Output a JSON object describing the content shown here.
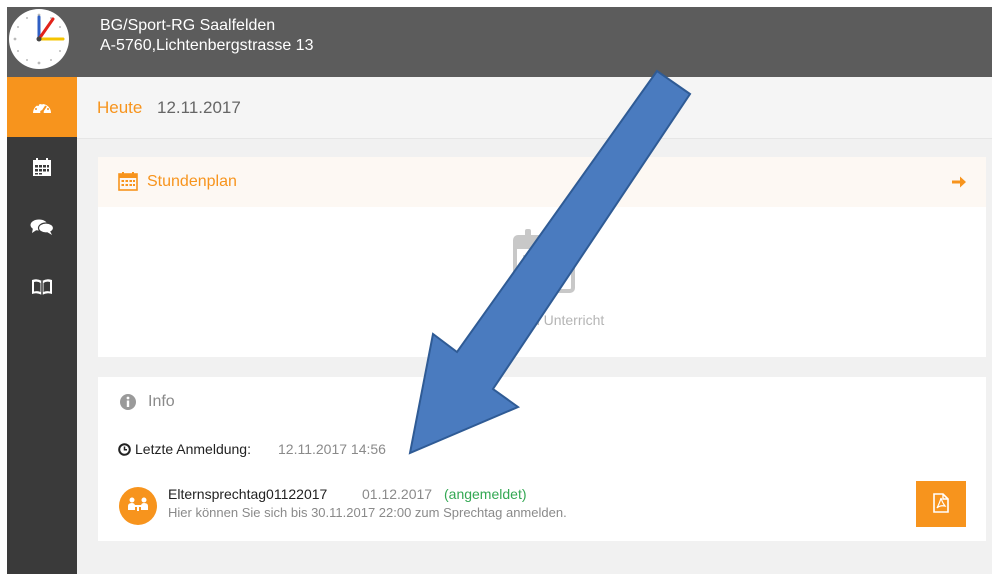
{
  "school": {
    "name": "BG/Sport-RG Saalfelden",
    "address": "A-5760,Lichtenbergstrasse 13"
  },
  "sidebar": {
    "items": [
      {
        "icon": "dashboard-icon",
        "active": true
      },
      {
        "icon": "calendar-icon",
        "active": false
      },
      {
        "icon": "chat-icon",
        "active": false
      },
      {
        "icon": "book-icon",
        "active": false
      }
    ]
  },
  "header": {
    "label": "Heute",
    "date": "12.11.2017"
  },
  "stundenplan": {
    "title": "Stundenplan",
    "empty_text": "Kein Unterricht"
  },
  "info": {
    "title": "Info",
    "last_login_label": "Letzte Anmeldung:",
    "last_login_value": "12.11.2017 14:56",
    "event": {
      "title": "Elternsprechtag01122017",
      "date": "01.12.2017",
      "status": "(angemeldet)",
      "description": "Hier können Sie sich bis 30.11.2017 22:00 zum Sprechtag anmelden."
    }
  },
  "colors": {
    "accent": "#f7941d",
    "topbar": "#5c5c5c",
    "sidebar": "#3a3a3a",
    "status_green": "#33a853",
    "annotation_arrow": "#4a7bbf"
  }
}
